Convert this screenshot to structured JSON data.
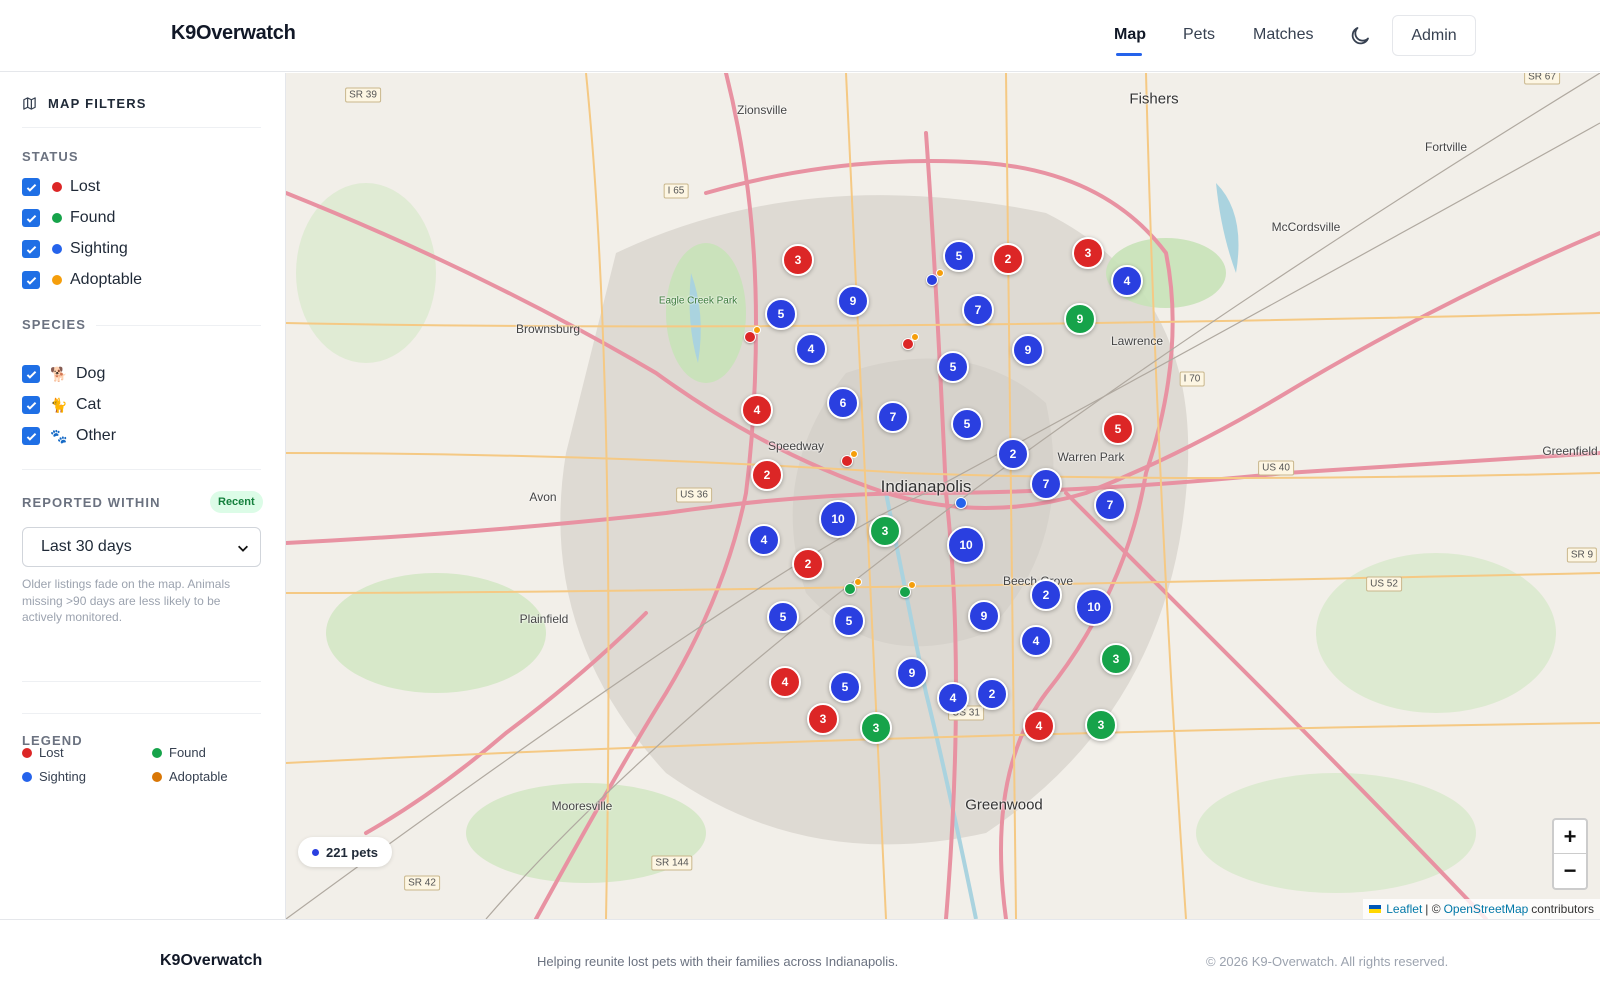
{
  "app": {
    "title": "K9Overwatch"
  },
  "nav": {
    "items": [
      {
        "label": "Map",
        "active": true
      },
      {
        "label": "Pets",
        "active": false
      },
      {
        "label": "Matches",
        "active": false
      }
    ],
    "theme_icon": "moon-icon",
    "admin_label": "Admin"
  },
  "sidebar": {
    "title": "MAP FILTERS",
    "title_icon": "map-icon",
    "status": {
      "heading": "STATUS",
      "items": [
        {
          "label": "Lost",
          "checked": true,
          "color": "#dc2626"
        },
        {
          "label": "Found",
          "checked": true,
          "color": "#16a34a"
        },
        {
          "label": "Sighting",
          "checked": true,
          "color": "#2563eb"
        },
        {
          "label": "Adoptable",
          "checked": true,
          "color": "#f59e0b"
        }
      ]
    },
    "species": {
      "heading": "SPECIES",
      "items": [
        {
          "label": "Dog",
          "checked": true,
          "icon": "dog-icon",
          "glyph": "🐕"
        },
        {
          "label": "Cat",
          "checked": true,
          "icon": "cat-icon",
          "glyph": "🐈"
        },
        {
          "label": "Other",
          "checked": true,
          "icon": "paw-icon",
          "glyph": "🐾"
        }
      ]
    },
    "reported_within": {
      "heading": "REPORTED WITHIN",
      "badge": "Recent",
      "selected": "Last 30 days",
      "hint": "Older listings fade on the map. Animals missing >90 days are less likely to be actively monitored."
    },
    "legend": {
      "heading": "LEGEND",
      "items": [
        {
          "label": "Lost",
          "color": "#dc2626"
        },
        {
          "label": "Found",
          "color": "#16a34a"
        },
        {
          "label": "Sighting",
          "color": "#2563eb"
        },
        {
          "label": "Adoptable",
          "color": "#d97706"
        }
      ]
    }
  },
  "map": {
    "pet_count": "221 pets",
    "zoom_in": "+",
    "zoom_out": "−",
    "attribution": {
      "leaflet": "Leaflet",
      "sep": "| ©",
      "osm": "OpenStreetMap",
      "suffix": "contributors"
    },
    "colors": {
      "lost": "#dc2626",
      "found": "#16a34a",
      "sighting": "#2a3fe0",
      "adoptable": "#f59e0b"
    },
    "places": [
      {
        "name": "Indianapolis",
        "cls": "big"
      },
      {
        "name": "Fishers",
        "cls": "mid"
      },
      {
        "name": "Greenwood",
        "cls": "mid"
      },
      {
        "name": "Zionsville",
        "cls": ""
      },
      {
        "name": "Brownsburg",
        "cls": ""
      },
      {
        "name": "Speedway",
        "cls": ""
      },
      {
        "name": "Avon",
        "cls": ""
      },
      {
        "name": "Plainfield",
        "cls": ""
      },
      {
        "name": "Mooresville",
        "cls": ""
      },
      {
        "name": "Lawrence",
        "cls": ""
      },
      {
        "name": "Warren Park",
        "cls": ""
      },
      {
        "name": "Beech Grove",
        "cls": ""
      },
      {
        "name": "Fortville",
        "cls": ""
      },
      {
        "name": "McCordsville",
        "cls": ""
      },
      {
        "name": "Greenfield",
        "cls": ""
      },
      {
        "name": "Eagle Creek Park",
        "cls": ""
      }
    ],
    "shields": [
      "SR 39",
      "I 65",
      "SR 67",
      "I 70",
      "US 40",
      "US 36",
      "SR 9",
      "US 52",
      "SR 144",
      "US 31",
      "SR 42"
    ],
    "clusters": [
      {
        "type": "lost",
        "count": "3"
      },
      {
        "type": "sighting",
        "count": "5"
      },
      {
        "type": "lost",
        "count": "2"
      },
      {
        "type": "lost",
        "count": "3"
      },
      {
        "type": "sighting",
        "count": "4"
      },
      {
        "type": "sighting",
        "count": "9"
      },
      {
        "type": "sighting",
        "count": "5"
      },
      {
        "type": "sighting",
        "count": "7"
      },
      {
        "type": "found",
        "count": "9"
      },
      {
        "type": "sighting",
        "count": "4"
      },
      {
        "type": "sighting",
        "count": "9"
      },
      {
        "type": "sighting",
        "count": "5"
      },
      {
        "type": "lost",
        "count": "4"
      },
      {
        "type": "sighting",
        "count": "6"
      },
      {
        "type": "sighting",
        "count": "7"
      },
      {
        "type": "sighting",
        "count": "5"
      },
      {
        "type": "lost",
        "count": "5"
      },
      {
        "type": "sighting",
        "count": "2"
      },
      {
        "type": "lost",
        "count": "2"
      },
      {
        "type": "sighting",
        "count": "7"
      },
      {
        "type": "sighting",
        "count": "7"
      },
      {
        "type": "sighting",
        "count": "10"
      },
      {
        "type": "found",
        "count": "3"
      },
      {
        "type": "sighting",
        "count": "4"
      },
      {
        "type": "sighting",
        "count": "10"
      },
      {
        "type": "lost",
        "count": "2"
      },
      {
        "type": "sighting",
        "count": "2"
      },
      {
        "type": "sighting",
        "count": "10"
      },
      {
        "type": "sighting",
        "count": "5"
      },
      {
        "type": "sighting",
        "count": "5"
      },
      {
        "type": "sighting",
        "count": "9"
      },
      {
        "type": "sighting",
        "count": "4"
      },
      {
        "type": "found",
        "count": "3"
      },
      {
        "type": "lost",
        "count": "4"
      },
      {
        "type": "sighting",
        "count": "5"
      },
      {
        "type": "sighting",
        "count": "9"
      },
      {
        "type": "sighting",
        "count": "4"
      },
      {
        "type": "sighting",
        "count": "2"
      },
      {
        "type": "lost",
        "count": "3"
      },
      {
        "type": "found",
        "count": "3"
      },
      {
        "type": "lost",
        "count": "4"
      },
      {
        "type": "found",
        "count": "3"
      }
    ]
  },
  "footer": {
    "brand": "K9Overwatch",
    "tagline": "Helping reunite lost pets with their families across Indianapolis.",
    "copyright": "© 2026 K9-Overwatch. All rights reserved."
  }
}
